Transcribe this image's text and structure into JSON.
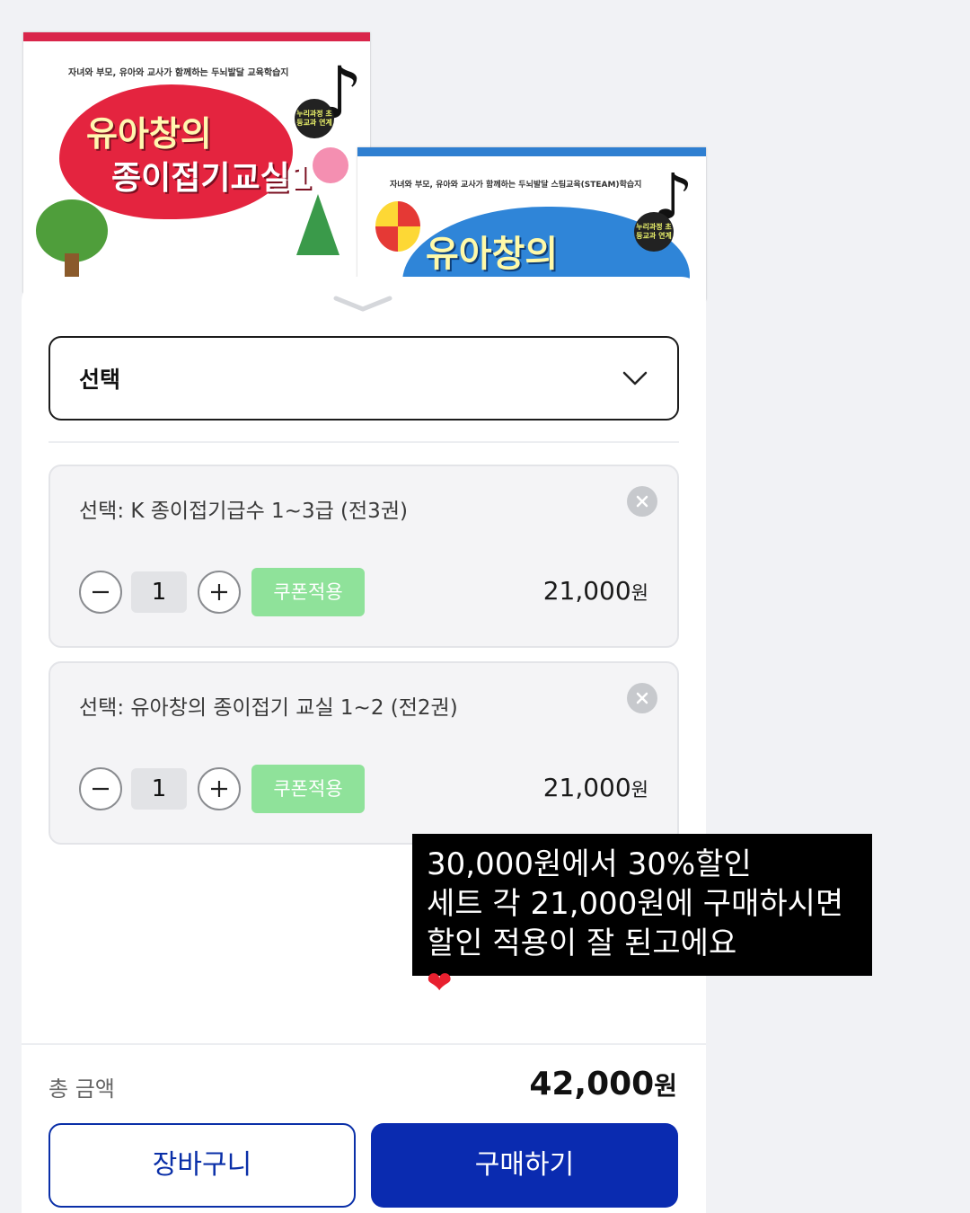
{
  "books": {
    "book1": {
      "subtitle": "자녀와 부모, 유아와 교사가 함께하는 두뇌발달 교육학습지",
      "title_line1": "유아창의",
      "title_line2": "종이접기교실1",
      "badge": "누리과정 초등교과 연계"
    },
    "book2": {
      "subtitle": "자녀와 부모, 유아와 교사가 함께하는 두뇌발달 스팀교육(STEAM)학습지",
      "title": "유아창의",
      "badge": "누리과정 초등교과 연계"
    }
  },
  "select": {
    "label": "선택"
  },
  "items": [
    {
      "name": "선택: K 종이접기급수 1~3급 (전3권)",
      "quantity": "1",
      "coupon_label": "쿠폰적용",
      "price": "21,000",
      "currency": "원"
    },
    {
      "name": "선택: 유아창의 종이접기 교실 1~2 (전2권)",
      "quantity": "1",
      "coupon_label": "쿠폰적용",
      "price": "21,000",
      "currency": "원"
    }
  ],
  "total": {
    "label": "총 금액",
    "value": "42,000",
    "currency": "원"
  },
  "buttons": {
    "cart": "장바구니",
    "buy": "구매하기"
  },
  "caption": {
    "line1": "30,000원에서 30%할인",
    "line2": "세트 각 21,000원에 구매하시면",
    "line3": "할인 적용이 잘 된고에요",
    "emoji": "❤"
  },
  "colors": {
    "primary": "#0a2bb0",
    "coupon": "#8fe29a",
    "book1_accent": "#d9254a",
    "book2_accent": "#2f7fd1"
  },
  "icons": [
    "chevron-down-icon",
    "close-icon",
    "minus-icon",
    "plus-icon",
    "sheet-handle-icon",
    "music-note-icon",
    "heart-emoji"
  ]
}
